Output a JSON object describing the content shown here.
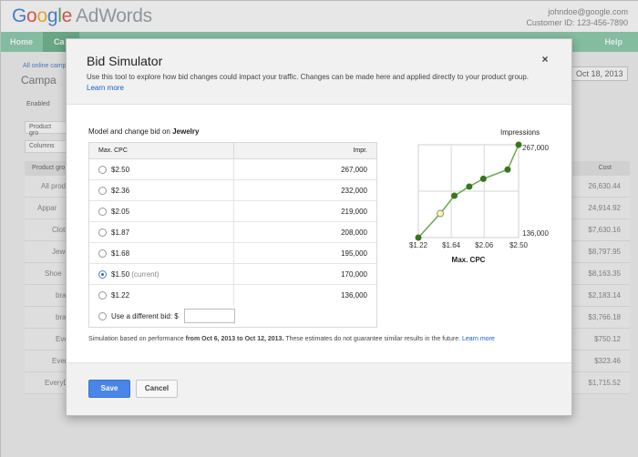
{
  "app": {
    "logo_google": [
      "G",
      "o",
      "o",
      "g",
      "l",
      "e"
    ],
    "logo_product": "AdWords",
    "account_email": "johndoe@google.com",
    "customer_id": "Customer ID: 123-456-7890"
  },
  "nav": {
    "home": "Home",
    "campaigns": "Ca",
    "help": "Help"
  },
  "background": {
    "breadcrumb": "All online camp",
    "title": "Campa",
    "date": "Oct 18, 2013",
    "status": "Enabled",
    "tab": "Product gro",
    "columns": "Columns",
    "table_head_left": "Product gro",
    "table_head_right": "Cost",
    "rows": [
      {
        "label": "All produ",
        "value": "26,630.44"
      },
      {
        "label": "Appar",
        "value": "24,914.92"
      },
      {
        "label": "Cloth",
        "value": "$7,630.16"
      },
      {
        "label": "Jewe",
        "value": "$8,797.95"
      },
      {
        "label": "Shoe",
        "value": "$8,163.35"
      },
      {
        "label": "bra",
        "value": "$2,183.14"
      },
      {
        "label": "bra",
        "value": "$3,766.18"
      },
      {
        "label": "Ever",
        "value": "$750.12"
      },
      {
        "label": "Every",
        "value": "$323.46"
      },
      {
        "label": "EveryD",
        "value": "$1,715.52"
      }
    ]
  },
  "modal": {
    "title": "Bid Simulator",
    "close": "×",
    "description": "Use this tool to explore how bid changes could impact your traffic. Changes can be made here and applied directly to your product group.",
    "learn_more": "Learn more",
    "section_prefix": "Model and change bid on ",
    "section_target": "Jewelry",
    "table": {
      "col_cpc": "Max. CPC",
      "col_impr": "Impr.",
      "rows": [
        {
          "cpc": "$2.50",
          "impr": "267,000",
          "note": "",
          "selected": false
        },
        {
          "cpc": "$2.36",
          "impr": "232,000",
          "note": "",
          "selected": false
        },
        {
          "cpc": "$2.05",
          "impr": "219,000",
          "note": "",
          "selected": false
        },
        {
          "cpc": "$1.87",
          "impr": "208,000",
          "note": "",
          "selected": false
        },
        {
          "cpc": "$1.68",
          "impr": "195,000",
          "note": "",
          "selected": false
        },
        {
          "cpc": "$1.50",
          "impr": "170,000",
          "note": "(current)",
          "selected": true
        },
        {
          "cpc": "$1.22",
          "impr": "136,000",
          "note": "",
          "selected": false
        }
      ],
      "custom_label": "Use a different bid: $",
      "custom_value": ""
    },
    "footnote_prefix": "Simulation based on performance ",
    "footnote_range": "from Oct 6, 2013 to Oct 12, 2013.",
    "footnote_suffix": " These estimates do not guarantee similar results in the future. ",
    "footnote_link": "Learn more",
    "save": "Save",
    "cancel": "Cancel"
  },
  "chart_data": {
    "type": "line",
    "title": "Impressions",
    "xlabel": "Max. CPC",
    "ylabel": "",
    "x": [
      1.22,
      1.5,
      1.68,
      1.87,
      2.05,
      2.36,
      2.5
    ],
    "y": [
      136000,
      170000,
      195000,
      208000,
      219000,
      232000,
      267000
    ],
    "highlight_index": 1,
    "xlim": [
      1.22,
      2.5
    ],
    "ylim": [
      136000,
      267000
    ],
    "x_ticks": [
      "$1.22",
      "$1.64",
      "$2.06",
      "$2.50"
    ],
    "x_tick_values": [
      1.22,
      1.64,
      2.06,
      2.5
    ],
    "y_tick_labels": [
      "136,000",
      "267,000"
    ],
    "grid": true,
    "line_color": "#6aa84f",
    "point_color": "#38761d",
    "highlight_color": "#f7f3c2"
  }
}
